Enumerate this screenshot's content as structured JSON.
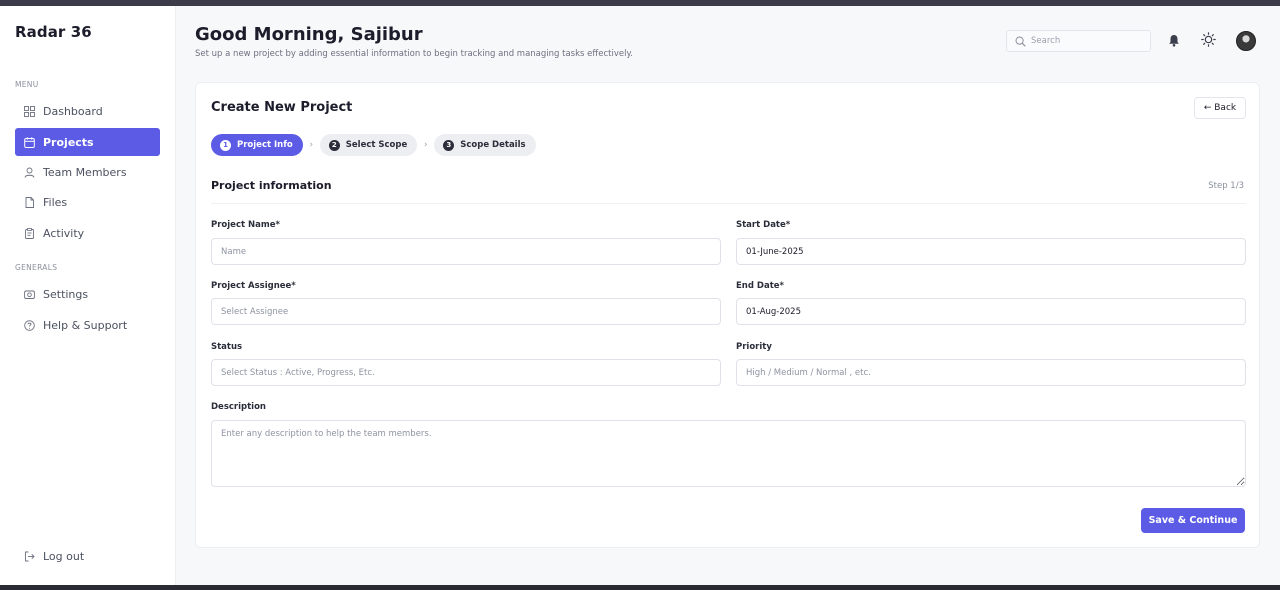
{
  "app": {
    "brand": "Radar 36"
  },
  "sidebar": {
    "menu_label": "MENU",
    "generals_label": "GENERALS",
    "items": [
      {
        "label": "Dashboard",
        "icon": "grid-icon"
      },
      {
        "label": "Projects",
        "icon": "calendar-icon"
      },
      {
        "label": "Team Members",
        "icon": "user-icon"
      },
      {
        "label": "Files",
        "icon": "file-icon"
      },
      {
        "label": "Activity",
        "icon": "clipboard-icon"
      }
    ],
    "generals": [
      {
        "label": "Settings",
        "icon": "camera-icon"
      },
      {
        "label": "Help & Support",
        "icon": "help-icon"
      }
    ],
    "logout_label": "Log out",
    "active_item": "Projects"
  },
  "header": {
    "greeting": "Good Morning, Sajibur",
    "subtitle": "Set up a new project by adding essential information to begin tracking and managing tasks effectively.",
    "search_placeholder": "Search"
  },
  "card": {
    "title": "Create New Project",
    "back_label": "← Back",
    "steps": [
      {
        "num": "1",
        "label": "Project Info"
      },
      {
        "num": "2",
        "label": "Select Scope"
      },
      {
        "num": "3",
        "label": "Scope Details"
      }
    ],
    "section_title": "Project information",
    "step_count": "Step 1/3",
    "fields": {
      "project_name": {
        "label": "Project Name*",
        "placeholder": "Name",
        "value": ""
      },
      "start_date": {
        "label": "Start Date*",
        "value": "01-June-2025"
      },
      "assignee": {
        "label": "Project Assignee*",
        "placeholder": "Select Assignee",
        "value": ""
      },
      "end_date": {
        "label": "End Date*",
        "value": "01-Aug-2025"
      },
      "status": {
        "label": "Status",
        "placeholder": "Select Status : Active, Progress, Etc.",
        "value": ""
      },
      "priority": {
        "label": "Priority",
        "placeholder": "High / Medium / Normal , etc.",
        "value": ""
      },
      "description": {
        "label": "Description",
        "placeholder": "Enter any description to help the team members.",
        "value": ""
      }
    },
    "save_label": "Save & Continue"
  },
  "colors": {
    "accent": "#5b5be6",
    "background": "#f7f8fa"
  }
}
